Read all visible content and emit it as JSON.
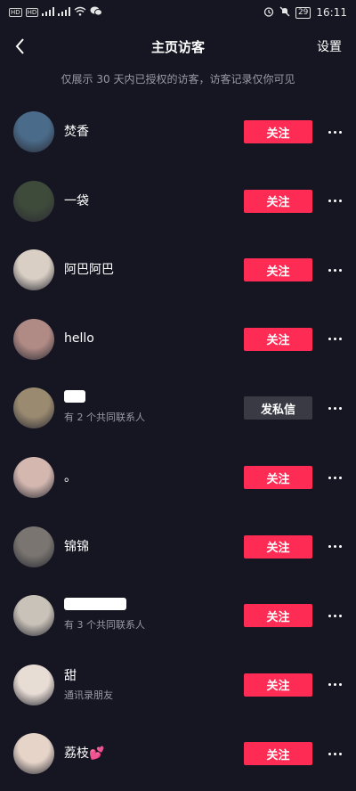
{
  "status_bar": {
    "left_badges": [
      "HD",
      "HD",
      "4G",
      "4G"
    ],
    "battery": "29",
    "time": "16:11"
  },
  "header": {
    "title": "主页访客",
    "settings_label": "设置"
  },
  "notice": "仅展示 30 天内已授权的访客，访客记录仅你可见",
  "visitors": [
    {
      "name": "焚香",
      "sub": "",
      "button": "关注",
      "button_style": "follow",
      "avatar_color": "#4a6b8a"
    },
    {
      "name": "一袋",
      "sub": "",
      "button": "关注",
      "button_style": "follow",
      "avatar_color": "#3e4a3a"
    },
    {
      "name": "阿巴阿巴",
      "sub": "",
      "button": "关注",
      "button_style": "follow",
      "avatar_color": "#d9cfc4"
    },
    {
      "name": "hello",
      "sub": "",
      "button": "关注",
      "button_style": "follow",
      "avatar_color": "#b08a84"
    },
    {
      "name": "",
      "sub": "有 2 个共同联系人",
      "button": "发私信",
      "button_style": "message",
      "avatar_color": "#9a8a70"
    },
    {
      "name": "。",
      "sub": "",
      "button": "关注",
      "button_style": "follow",
      "avatar_color": "#d4b8b0"
    },
    {
      "name": "锦锦",
      "sub": "",
      "button": "关注",
      "button_style": "follow",
      "avatar_color": "#7a7570"
    },
    {
      "name": "",
      "sub": "有 3 个共同联系人",
      "button": "关注",
      "button_style": "follow",
      "avatar_color": "#c9c2b8"
    },
    {
      "name": "甜",
      "sub": "通讯录朋友",
      "button": "关注",
      "button_style": "follow",
      "avatar_color": "#e8ddd5"
    },
    {
      "name": "荔枝💕",
      "sub": "",
      "button": "关注",
      "button_style": "follow",
      "avatar_color": "#e6d4c8"
    }
  ],
  "colors": {
    "background": "#161622",
    "follow_button": "#fe2c55",
    "message_button": "#3a3a44",
    "muted_text": "#9a9aa6"
  }
}
